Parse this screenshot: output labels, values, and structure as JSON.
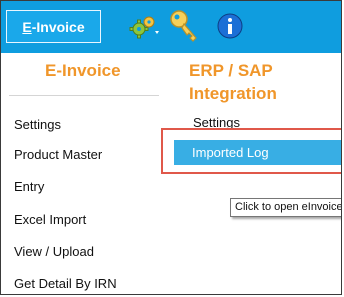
{
  "toolbar": {
    "einvoice_prefix": "E",
    "einvoice_rest": "-Invoice",
    "settings_icon": "gears-icon",
    "key_icon": "key-icon",
    "info_icon": "info-icon"
  },
  "column1": {
    "heading": "E-Invoice",
    "items": [
      "Settings",
      "Product Master",
      "Entry",
      "Excel Import",
      "View / Upload",
      "Get Detail By IRN"
    ]
  },
  "column2": {
    "heading_line1": "ERP / SAP",
    "heading_line2": "Integration",
    "settings_label": "Settings",
    "selected_label": "Imported Log"
  },
  "tooltip": {
    "text": "Click to open eInvoice"
  },
  "colors": {
    "toolbar_bg": "#0f9ddf",
    "heading": "#f0962a",
    "selected_bg": "#38aee4",
    "highlight_border": "#e0584a"
  }
}
